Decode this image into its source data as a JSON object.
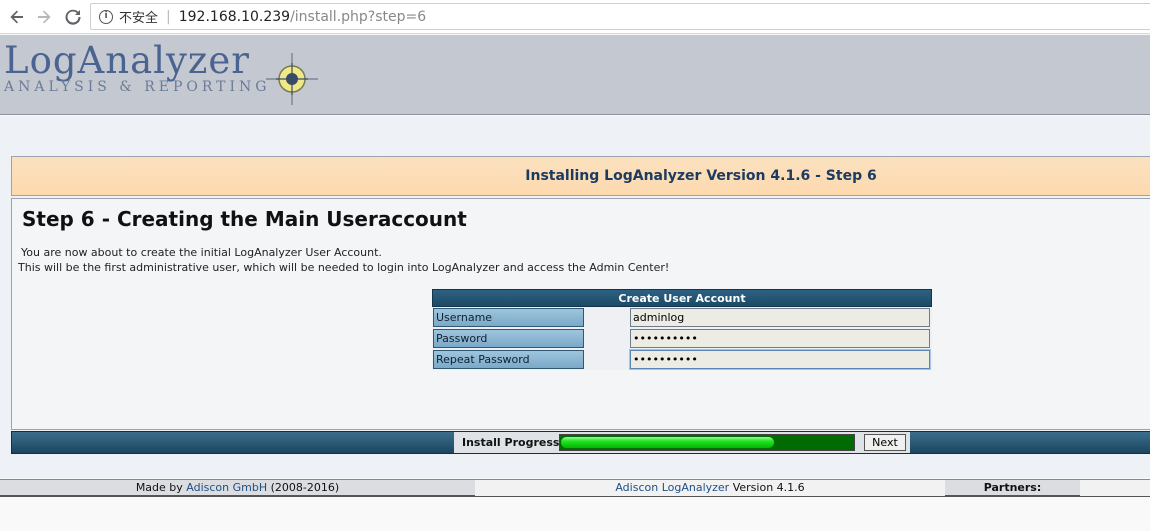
{
  "browser": {
    "info_glyph": "i",
    "insecure_label": "不安全",
    "separator": "|",
    "url_host": "192.168.10.239",
    "url_path": "/install.php?step=6"
  },
  "header": {
    "logo_main": "LogAnalyzer",
    "logo_sub": "ANALYSIS & REPORTING"
  },
  "title_bar": {
    "text": "Installing LogAnalyzer Version 4.1.6 - Step 6"
  },
  "main": {
    "heading": "Step 6 - Creating the Main Useraccount",
    "desc1": "You are now about to create the initial LogAnalyzer User Account.",
    "desc2": "This will be the first administrative user, which will be needed to login into LogAnalyzer and access the Admin Center!"
  },
  "form": {
    "header": "Create User Account",
    "username_label": "Username",
    "username_value": "adminlog",
    "password_label": "Password",
    "password_value": "••••••••••",
    "repeat_label": "Repeat Password",
    "repeat_value": "••••••••••"
  },
  "progress": {
    "label": "Install Progress:",
    "fraction": 0.73,
    "next_label": "Next"
  },
  "footer": {
    "made_by_prefix": "Made by ",
    "made_by_link": "Adiscon GmbH",
    "made_by_suffix": " (2008-2016)",
    "product_link": "Adiscon LogAnalyzer",
    "product_version": " Version 4.1.6",
    "partners_label": "Partners:"
  },
  "colors": {
    "accent_blue": "#1c4660",
    "title_bg": "#fdd9ae",
    "progress_green": "#00b800",
    "logo_color": "#4a6390"
  },
  "icons": {
    "back": "arrow-left-icon",
    "forward": "arrow-right-icon",
    "reload": "reload-icon",
    "info": "info-icon",
    "logo_mark": "crosshair-icon"
  }
}
